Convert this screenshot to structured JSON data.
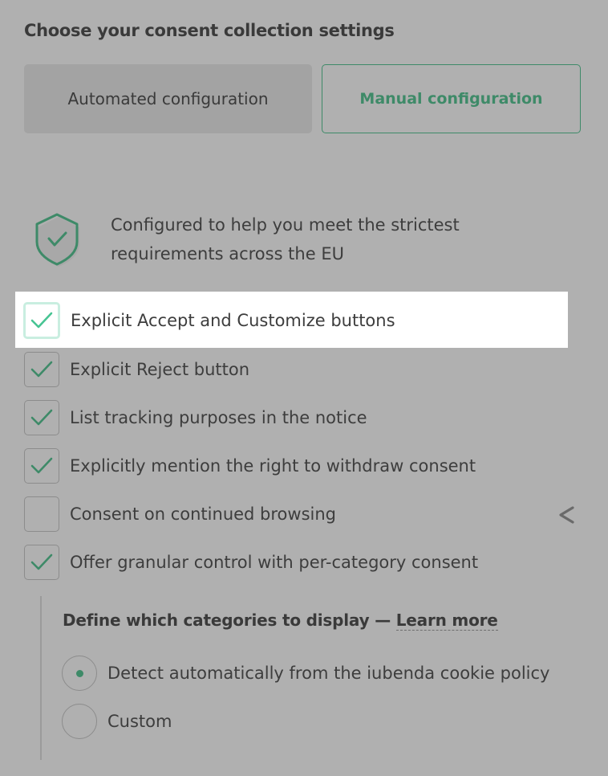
{
  "heading": "Choose your consent collection settings",
  "tabs": {
    "automated": "Automated configuration",
    "manual": "Manual configuration"
  },
  "compliance": {
    "icon": "shield-check-icon",
    "text": "Configured to help you meet the strictest requirements across the EU"
  },
  "options": [
    {
      "label": "Explicit Accept and Customize buttons",
      "checked": true
    },
    {
      "label": "Explicit Reject button",
      "checked": true
    },
    {
      "label": "List tracking purposes in the notice",
      "checked": true
    },
    {
      "label": "Explicitly mention the right to withdraw consent",
      "checked": true
    },
    {
      "label": "Consent on continued browsing",
      "checked": false
    },
    {
      "label": "Offer granular control with per-category consent",
      "checked": true
    }
  ],
  "categories": {
    "heading": "Define which categories to display —",
    "learn_more": "Learn more",
    "options": [
      {
        "label": "Detect automatically from the iubenda cookie policy",
        "selected": true
      },
      {
        "label": "Custom",
        "selected": false
      }
    ]
  },
  "colors": {
    "accent": "#3e8a68",
    "check_bright": "#47c493",
    "background": "#b0b0b0"
  }
}
